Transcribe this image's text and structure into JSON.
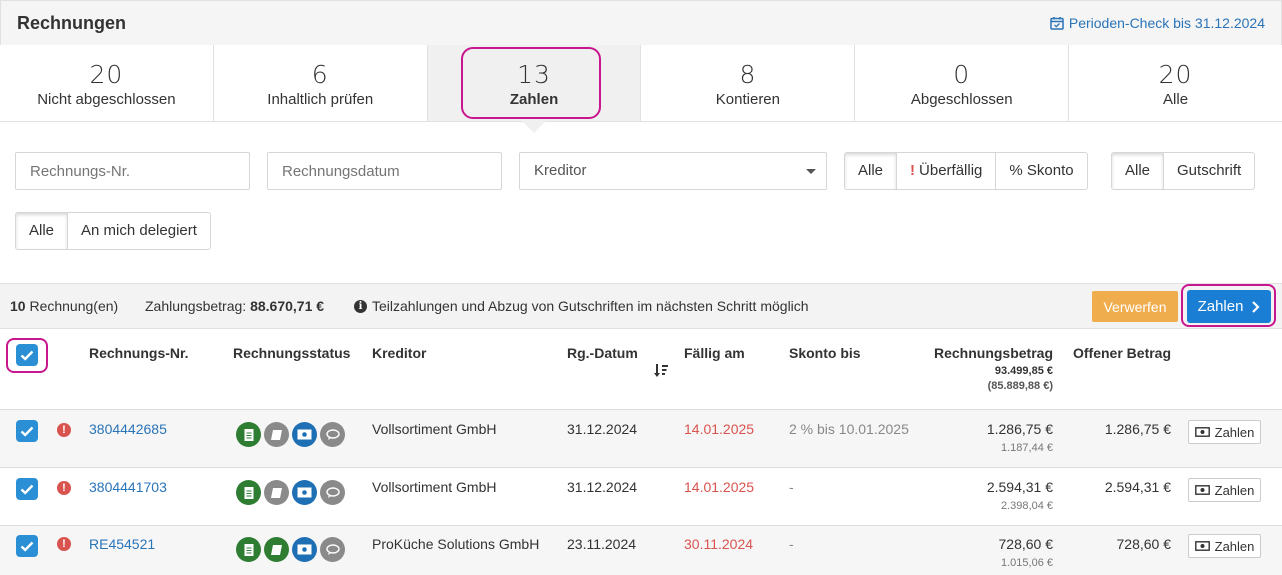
{
  "header": {
    "title": "Rechnungen",
    "period_check": "Perioden-Check bis 31.12.2024"
  },
  "tabs": [
    {
      "count": "20",
      "label": "Nicht abgeschlossen"
    },
    {
      "count": "6",
      "label": "Inhaltlich prüfen"
    },
    {
      "count": "13",
      "label": "Zahlen"
    },
    {
      "count": "8",
      "label": "Kontieren"
    },
    {
      "count": "0",
      "label": "Abgeschlossen"
    },
    {
      "count": "20",
      "label": "Alle"
    }
  ],
  "filters": {
    "invoice_no_placeholder": "Rechnungs-Nr.",
    "invoice_date_placeholder": "Rechnungsdatum",
    "creditor_select": "Kreditor",
    "due_group": [
      "Alle",
      "Überfällig",
      "% Skonto"
    ],
    "due_warn_mark": "!",
    "credit_group": [
      "Alle",
      "Gutschrift"
    ],
    "delegation_group": [
      "Alle",
      "An mich delegiert"
    ]
  },
  "summary": {
    "count": "10",
    "count_suffix": " Rechnung(en)",
    "amount_label": "Zahlungsbetrag: ",
    "amount": "88.670,71 €",
    "info_icon": "i",
    "info_text": "Teilzahlungen und Abzug von Gutschriften im nächsten Schritt möglich",
    "discard_button": "Verwerfen",
    "pay_button": "Zahlen"
  },
  "table": {
    "headers": {
      "invoice_no": "Rechnungs-Nr.",
      "status": "Rechnungsstatus",
      "creditor": "Kreditor",
      "date": "Rg.-Datum",
      "due": "Fällig am",
      "skonto": "Skonto bis",
      "amount": "Rechnungsbetrag",
      "amount_total": "93.499,85 €",
      "amount_total_paren": "(85.889,88 €)",
      "open": "Offener Betrag"
    },
    "rows": [
      {
        "alert": "!",
        "invoice_no": "3804442685",
        "creditor": "Vollsortiment GmbH",
        "date": "31.12.2024",
        "due": "14.01.2025",
        "skonto": "2 % bis 10.01.2025",
        "amount": "1.286,75 €",
        "amount_sub": "1.187,44 €",
        "open": "1.286,75 €",
        "action": "Zahlen"
      },
      {
        "alert": "!",
        "invoice_no": "3804441703",
        "creditor": "Vollsortiment GmbH",
        "date": "31.12.2024",
        "due": "14.01.2025",
        "skonto": "-",
        "amount": "2.594,31 €",
        "amount_sub": "2.398,04 €",
        "open": "2.594,31 €",
        "action": "Zahlen"
      },
      {
        "alert": "!",
        "invoice_no": "RE454521",
        "creditor": "ProKüche Solutions GmbH",
        "date": "23.11.2024",
        "due": "30.11.2024",
        "skonto": "-",
        "amount": "728,60 €",
        "amount_sub": "1.015,06 €",
        "open": "728,60 €",
        "action": "Zahlen"
      }
    ]
  },
  "colors": {
    "accent_blue": "#1a7fd4",
    "link_blue": "#2a74b8",
    "overdue_red": "#d9534f",
    "discard_orange": "#f0ad4e",
    "highlight_magenta": "#c8168f",
    "status_green": "#2e7d32"
  }
}
